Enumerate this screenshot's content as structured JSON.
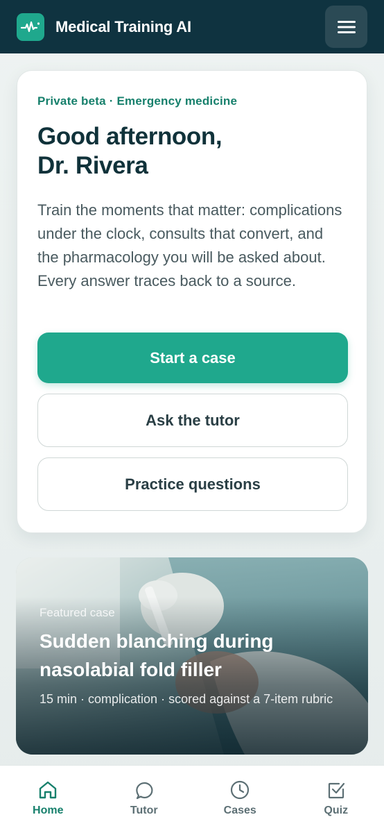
{
  "header": {
    "app_title": "Medical Training AI",
    "logo_icon": "pulse-icon",
    "menu_icon": "hamburger-icon"
  },
  "hero": {
    "eyebrow": "Private beta · Emergency medicine",
    "greeting_line1": "Good afternoon,",
    "greeting_line2": "Dr. Rivera",
    "intro": "Train the moments that matter: complications under the clock, consults that convert, and the pharmacology you will be asked about. Every answer traces back to a source.",
    "primary_button": "Start a case",
    "tutor_button": "Ask the tutor",
    "practice_button": "Practice questions"
  },
  "featured": {
    "label": "Featured case",
    "title": "Sudden blanching during nasolabial fold filler",
    "meta": "15 min · complication · scored against a 7-item rubric"
  },
  "nav": {
    "items": [
      {
        "label": "Home",
        "icon": "home-icon",
        "active": true
      },
      {
        "label": "Tutor",
        "icon": "chat-bubble-icon",
        "active": false
      },
      {
        "label": "Cases",
        "icon": "clock-icon",
        "active": false
      },
      {
        "label": "Quiz",
        "icon": "checkbox-icon",
        "active": false
      }
    ]
  },
  "colors": {
    "header_bg": "#0f3340",
    "accent": "#1fa88d",
    "accent_text": "#17806c",
    "nav_inactive": "#5c6f74"
  }
}
